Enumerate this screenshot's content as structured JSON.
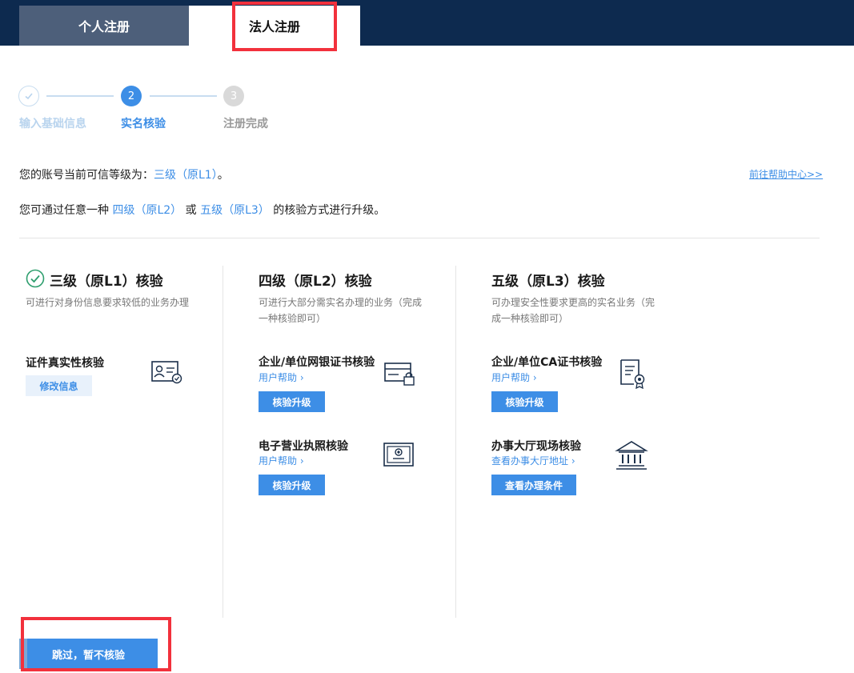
{
  "tabs": {
    "personal": "个人注册",
    "legal": "法人注册"
  },
  "steps": [
    {
      "label": "输入基础信息",
      "state": "done"
    },
    {
      "label": "实名核验",
      "number": "2",
      "state": "active"
    },
    {
      "label": "注册完成",
      "number": "3",
      "state": "pending"
    }
  ],
  "info": {
    "line1_prefix": "您的账号当前可信等级为：",
    "line1_level": "三级（原L1）",
    "line1_suffix": "。",
    "line2_prefix": "您可通过任意一种",
    "line2_level_a": "四级（原L2）",
    "line2_or": "或",
    "line2_level_b": "五级（原L3）",
    "line2_suffix": "的核验方式进行升级。",
    "help_link": "前往帮助中心>>"
  },
  "columns": [
    {
      "title": "三级（原L1）核验",
      "desc": "可进行对身份信息要求较低的业务办理",
      "items": [
        {
          "title": "证件真实性核验",
          "button": "修改信息",
          "icon": "id-card-icon"
        }
      ]
    },
    {
      "title": "四级（原L2）核验",
      "desc": "可进行大部分需实名办理的业务（完成一种核验即可）",
      "items": [
        {
          "title": "企业/单位网银证书核验",
          "link": "用户帮助 ›",
          "button": "核验升级",
          "icon": "bank-card-lock-icon"
        },
        {
          "title": "电子营业执照核验",
          "link": "用户帮助 ›",
          "button": "核验升级",
          "icon": "business-license-icon"
        }
      ]
    },
    {
      "title": "五级（原L3）核验",
      "desc": "可办理安全性要求更高的实名业务（完成一种核验即可）",
      "items": [
        {
          "title": "企业/单位CA证书核验",
          "link": "用户帮助 ›",
          "button": "核验升级",
          "icon": "certificate-icon"
        },
        {
          "title": "办事大厅现场核验",
          "link": "查看办事大厅地址 ›",
          "button": "查看办理条件",
          "icon": "government-hall-icon"
        }
      ]
    }
  ],
  "skip_button": "跳过，暂不核验",
  "colors": {
    "header": "#0d2a4f",
    "accent": "#3d8ee6",
    "highlight": "#f2313c",
    "done": "#2e9e6e"
  }
}
